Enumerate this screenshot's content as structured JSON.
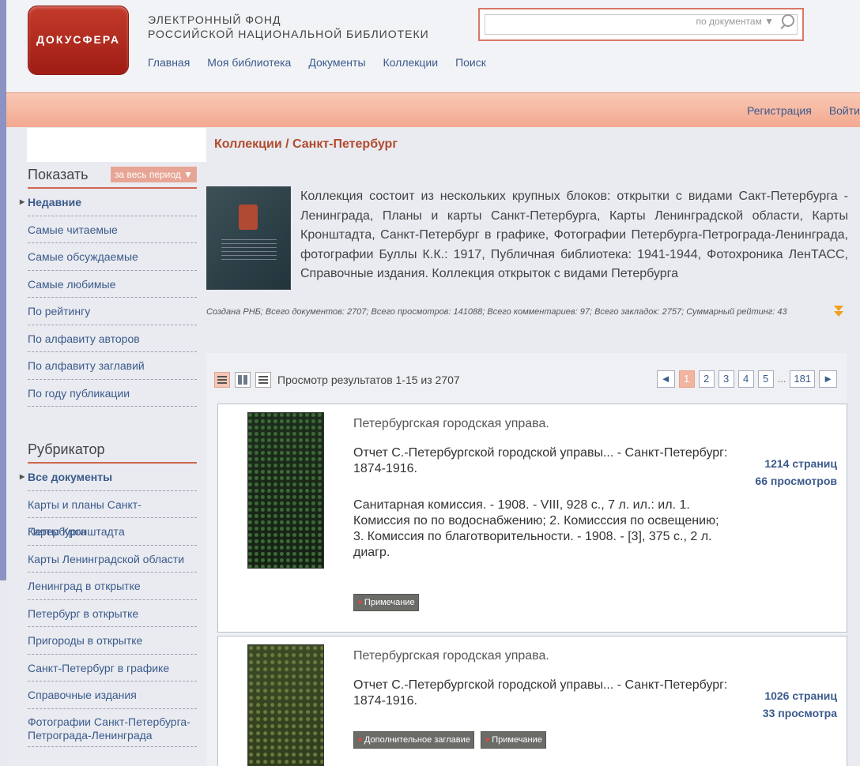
{
  "header": {
    "logo_text": "ДОКУСФЕРА",
    "title_line1": "ЭЛЕКТРОННЫЙ ФОНД",
    "title_line2": "РОССИЙСКОЙ НАЦИОНАЛЬНОЙ БИБЛИОТЕКИ",
    "nav": [
      "Главная",
      "Моя библиотека",
      "Документы",
      "Коллекции",
      "Поиск"
    ],
    "search_scope": "по документам ▼"
  },
  "auth": {
    "register": "Регистрация",
    "login": "Войти"
  },
  "breadcrumb": "Коллекции / Санкт-Петербург",
  "sidebar": {
    "show_label": "Показать",
    "period_label": "за весь период ▼",
    "show_items": [
      "Недавние",
      "Самые читаемые",
      "Самые обсуждаемые",
      "Самые любимые",
      "По рейтингу",
      "По алфавиту авторов",
      "По алфавиту заглавий",
      "По году публикации"
    ],
    "rubricator_label": "Рубрикатор",
    "rubric_items": [
      "Все документы",
      "Карты и планы Санкт-Петербурга",
      "Карты Кронштадта",
      "Карты Ленинградской области",
      "Ленинград в открытке",
      "Петербург в открытке",
      "Пригороды в открытке",
      "Санкт-Петербург в графике",
      "Справочные издания",
      "Фотографии Санкт-Петербурга-Петрограда-Ленинграда"
    ]
  },
  "collection": {
    "description": "Коллекция состоит из нескольких крупных блоков: открытки с видами Сакт-Петербурга - Ленинграда, Планы и карты Санкт-Петербурга, Карты Ленинградской области, Карты Кронштадта, Санкт-Петербург в графике, Фотографии Петербурга-Петрограда-Ленинграда, фотографии Буллы К.К.: 1917, Публичная библиотека: 1941-1944, Фотохроника ЛенТАСС, Справочные издания. Коллекция открыток с видами Петербурга",
    "stats": "Создана РНБ; Всего документов: 2707; Всего просмотров: 141088; Всего комментариев: 97; Всего закладок: 2757; Суммарный рейтинг: 43"
  },
  "results": {
    "summary": "Просмотр результатов 1-15 из 2707",
    "pages": [
      "1",
      "2",
      "3",
      "4",
      "5",
      "...",
      "181"
    ],
    "prev": "◄",
    "next": "►",
    "items": [
      {
        "title": "Петербургская городская управа.",
        "line1": "Отчет С.-Петербургской городской управы... - Санкт-Петербург: 1874-1916.",
        "line2": "Санитарная комиссия. - 1908. - VIII, 928 с., 7 л. ил.: ил. 1. Комиссия по по водоснабжению; 2. Комисссия по освещению; 3. Комиссия по благотворительности. - 1908. - [3], 375 с., 2 л. диагр.",
        "pages": "1214 страниц",
        "views": "66 просмотров",
        "tags": [
          "Примечание"
        ]
      },
      {
        "title": "Петербургская городская управа.",
        "line1": "Отчет С.-Петербургской городской управы... - Санкт-Петербург: 1874-1916.",
        "pages": "1026 страниц",
        "views": "33 просмотра",
        "tags": [
          "Дополнительное заглавие",
          "Примечание"
        ]
      }
    ]
  }
}
